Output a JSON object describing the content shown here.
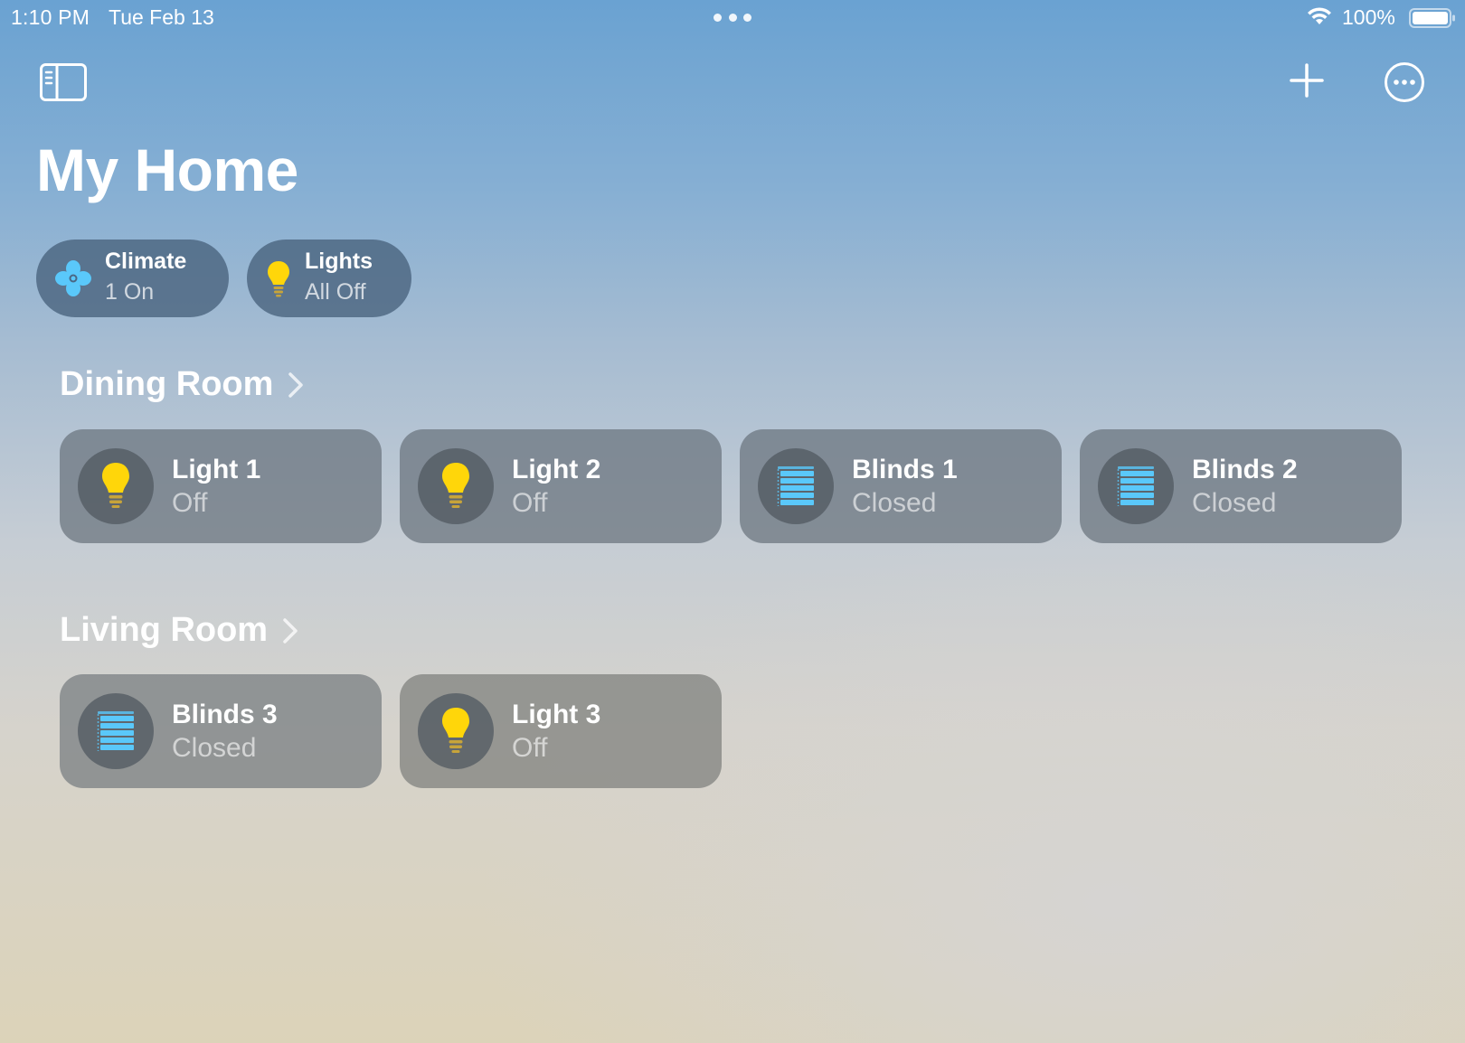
{
  "status_bar": {
    "time": "1:10 PM",
    "date": "Tue Feb 13",
    "battery": "100%"
  },
  "toolbar": {
    "icons": [
      "sidebar-toggle-icon",
      "plus-icon",
      "ellipsis-circle-icon"
    ]
  },
  "page": {
    "title": "My Home"
  },
  "categories": [
    {
      "title": "Climate",
      "subtitle": "1 On",
      "icon": "fan-icon",
      "icon_color": "#5ac8fa"
    },
    {
      "title": "Lights",
      "subtitle": "All Off",
      "icon": "lightbulb-icon",
      "icon_color": "#ffd60a"
    }
  ],
  "rooms": [
    {
      "name": "Dining Room",
      "accessories": [
        {
          "name": "Light 1",
          "status": "Off",
          "icon": "lightbulb-icon"
        },
        {
          "name": "Light 2",
          "status": "Off",
          "icon": "lightbulb-icon"
        },
        {
          "name": "Blinds 1",
          "status": "Closed",
          "icon": "blinds-icon"
        },
        {
          "name": "Blinds 2",
          "status": "Closed",
          "icon": "blinds-icon"
        }
      ]
    },
    {
      "name": "Living Room",
      "accessories": [
        {
          "name": "Blinds 3",
          "status": "Closed",
          "icon": "blinds-icon"
        },
        {
          "name": "Light 3",
          "status": "Off",
          "icon": "lightbulb-icon"
        }
      ]
    }
  ],
  "colors": {
    "bulb": "#ffd60a",
    "blinds": "#5ac8fa",
    "tile_bg": "#69737d"
  }
}
